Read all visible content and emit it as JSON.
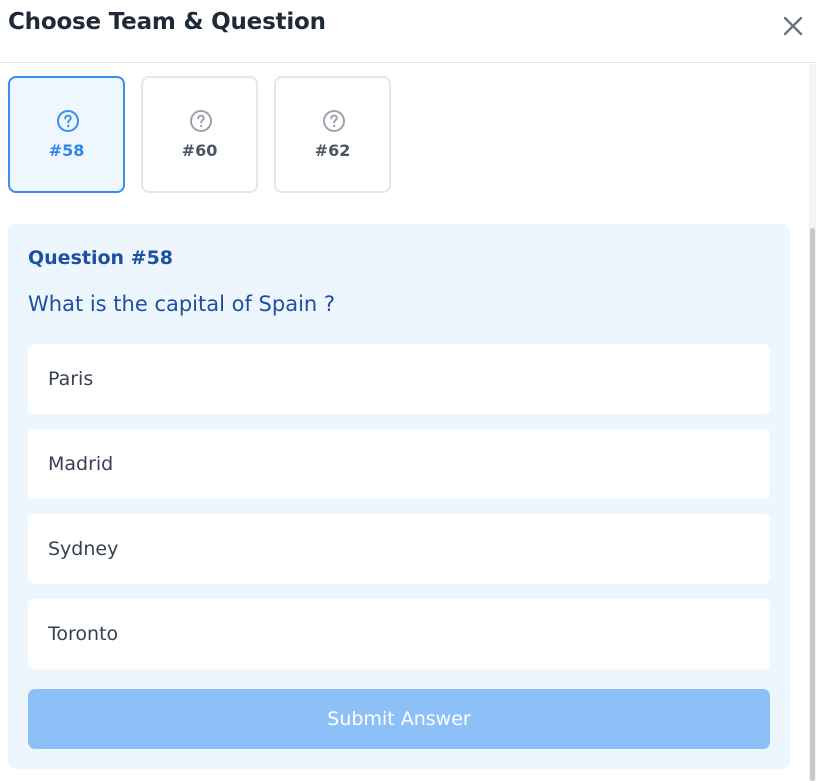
{
  "dialog": {
    "title": "Choose Team & Question",
    "close_icon": "close-icon"
  },
  "tabs": [
    {
      "label": "#58",
      "icon": "question-circle-icon",
      "active": true
    },
    {
      "label": "#60",
      "icon": "question-circle-icon",
      "active": false
    },
    {
      "label": "#62",
      "icon": "question-circle-icon",
      "active": false
    }
  ],
  "question": {
    "number_label": "Question #58",
    "text": "What is the capital of Spain ?",
    "options": [
      "Paris",
      "Madrid",
      "Sydney",
      "Toronto"
    ]
  },
  "submit": {
    "label": "Submit Answer"
  },
  "colors": {
    "accent": "#3b8ef0",
    "accent_text": "#2f86eb",
    "question_text": "#1e4fa3",
    "card_background": "#eef6fd",
    "submit_disabled": "#8cc0f6"
  }
}
